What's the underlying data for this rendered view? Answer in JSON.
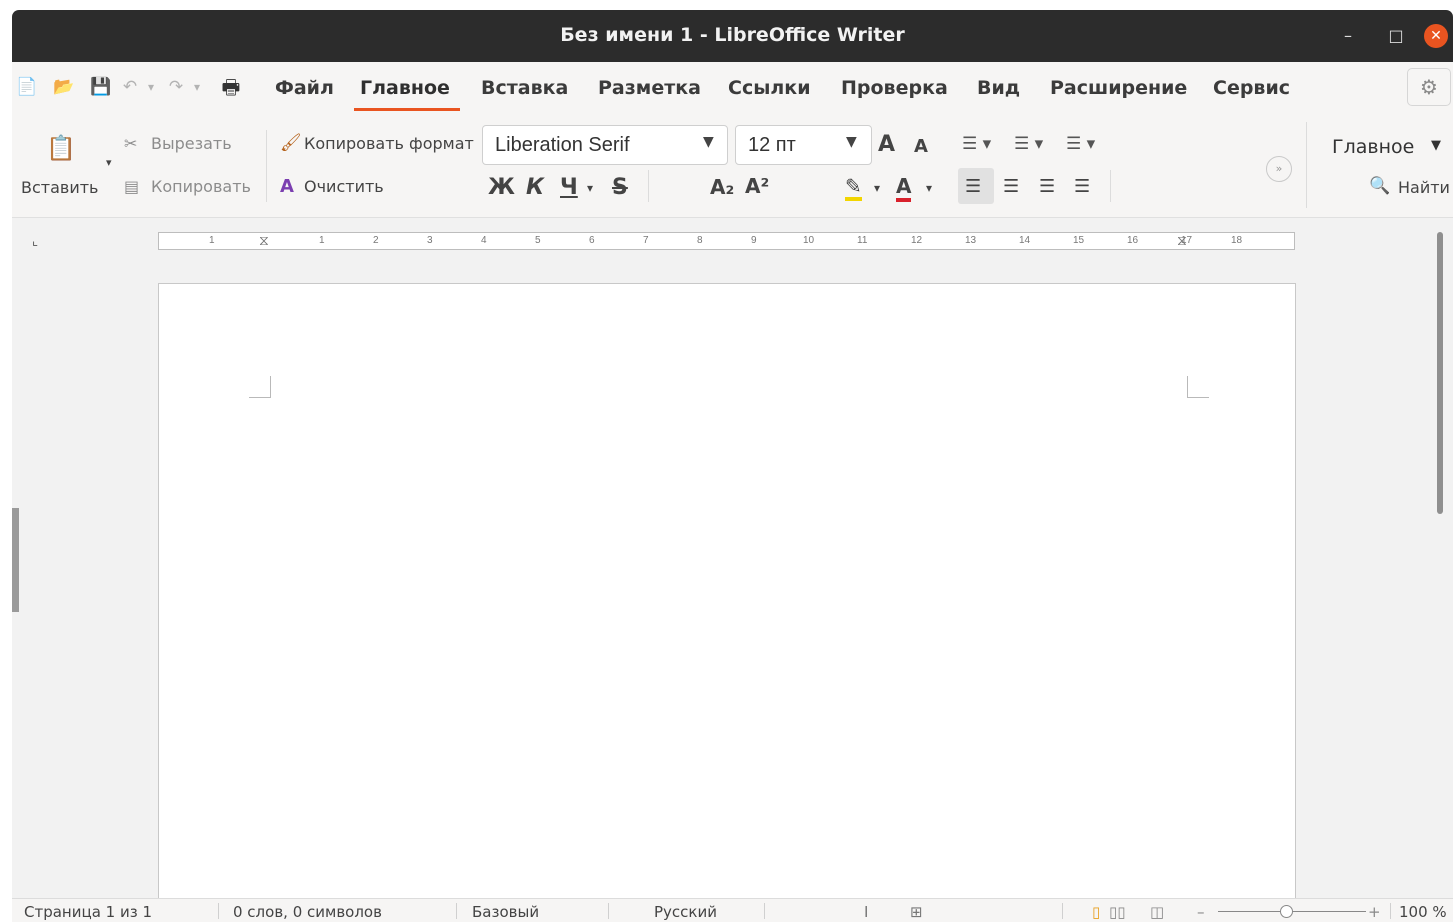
{
  "window": {
    "title": "Без имени 1 - LibreOffice Writer",
    "controls": {
      "minimize": "–",
      "maximize": "□",
      "close": "✕"
    }
  },
  "quick_access": {
    "new_icon": "📄",
    "open_icon": "📂",
    "save_icon": "💾",
    "undo_icon": "↶",
    "redo_icon": "↷",
    "print_icon": "🖶",
    "dropdown_glyph": "▾"
  },
  "menu": {
    "items": [
      "Файл",
      "Главное",
      "Вставка",
      "Разметка",
      "Ссылки",
      "Проверка",
      "Вид",
      "Расширение",
      "Сервис"
    ],
    "active_index": 1,
    "accent_color": "#e95420",
    "settings_icon": "⚙"
  },
  "toolbar": {
    "paste_label": "Вставить",
    "cut_label": "Вырезать",
    "copy_label": "Копировать",
    "clone_format_label": "Копировать формат",
    "clear_label": "Очистить",
    "font_name": "Liberation Serif",
    "font_size": "12 пт",
    "grow_font": "A",
    "shrink_font": "A",
    "bold": "Ж",
    "italic": "К",
    "underline": "Ч",
    "strikethrough": "S",
    "subscript": "A₂",
    "superscript": "A²",
    "highlight_icon": "✎",
    "font_color_icon": "A",
    "highlight_color": "#f2d500",
    "font_color": "#d9212c",
    "expand_icon": "»",
    "tab_dropdown_label": "Главное",
    "find_label": "Найти",
    "find_icon": "🔍"
  },
  "ruler": {
    "labels": [
      "1",
      "1",
      "2",
      "3",
      "4",
      "5",
      "6",
      "7",
      "8",
      "9",
      "10",
      "11",
      "12",
      "13",
      "14",
      "15",
      "16",
      "17",
      "18"
    ],
    "tabstop_symbol": "⌞"
  },
  "statusbar": {
    "page": "Страница 1 из 1",
    "words": "0 слов, 0 символов",
    "style": "Базовый",
    "language": "Русский",
    "insert_mode_icon": "I",
    "selection_mode_icon": "⊞",
    "view_single": "▯",
    "view_multi": "▯▯",
    "view_book": "◫",
    "zoom_minus": "–",
    "zoom_plus": "+",
    "zoom": "100 %",
    "zoom_level_percent": 100
  }
}
